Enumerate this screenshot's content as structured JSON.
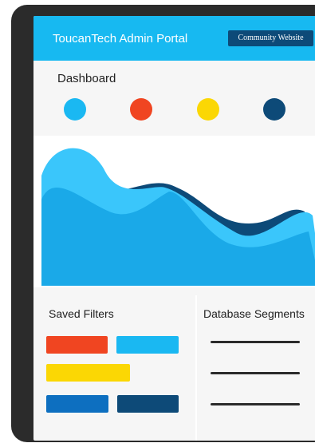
{
  "header": {
    "title": "ToucanTech Admin Portal",
    "community_button_label": "Community Website"
  },
  "dashboard": {
    "title": "Dashboard",
    "status_dots": [
      {
        "color": "#1ab8f2"
      },
      {
        "color": "#f04521"
      },
      {
        "color": "#fbd704"
      },
      {
        "color": "#0d4a78"
      }
    ]
  },
  "saved_filters": {
    "title": "Saved Filters",
    "chips": [
      {
        "color": "#f04521"
      },
      {
        "color": "#1ab8f2"
      },
      {
        "color": "#fbd704"
      },
      {
        "color": "#0d6fc0"
      },
      {
        "color": "#0d4a78"
      }
    ]
  },
  "database_segments": {
    "title": "Database Segments",
    "item_count": 3
  },
  "colors": {
    "brand_blue": "#17b9f1",
    "navy": "#0d4a78",
    "red": "#f04521",
    "yellow": "#fbd704",
    "mid_blue": "#0d6fc0"
  }
}
